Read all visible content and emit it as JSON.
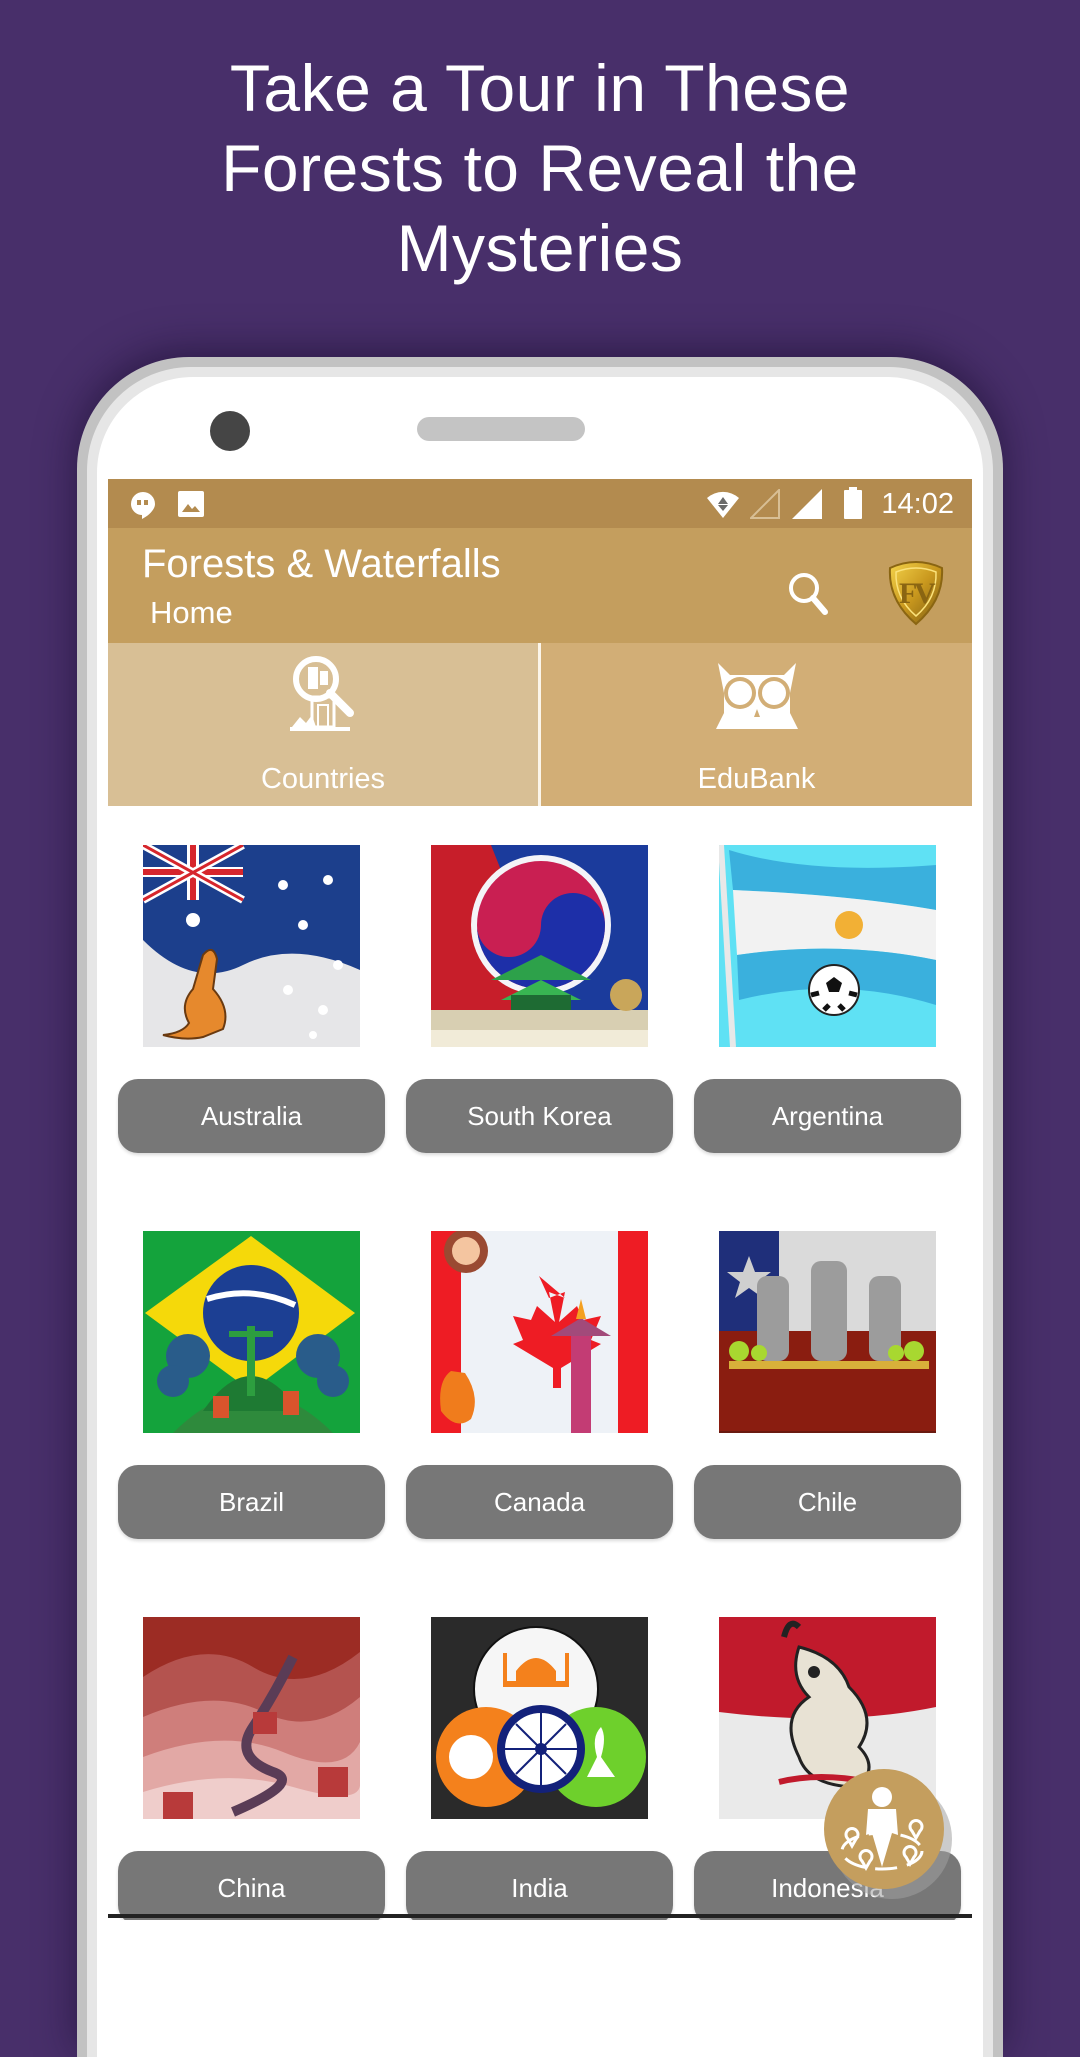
{
  "promo": {
    "headline_lines": [
      "Take a Tour in These",
      "Forests to Reveal the",
      "Mysteries"
    ],
    "background_color": "#482f6a"
  },
  "status_bar": {
    "left_icons": [
      "hangouts-icon",
      "image-notification-icon"
    ],
    "right_icons": [
      "wifi-icon",
      "signal-empty-icon",
      "signal-full-icon",
      "battery-icon"
    ],
    "time": "14:02"
  },
  "app_bar": {
    "title": "Forests & Waterfalls",
    "subtitle": "Home",
    "actions": [
      "search-icon",
      "app-logo-fv"
    ],
    "color": "#c49e5e"
  },
  "tabs": [
    {
      "label": "Countries",
      "icon": "country-search-icon",
      "color": "#d8bf95"
    },
    {
      "label": "EduBank",
      "icon": "owl-icon",
      "color": "#d2ae76"
    }
  ],
  "countries": [
    {
      "name": "Australia",
      "image": "australia-flag-kangaroo"
    },
    {
      "name": "South Korea",
      "image": "south-korea-flag-palace"
    },
    {
      "name": "Argentina",
      "image": "argentina-flag-football"
    },
    {
      "name": "Brazil",
      "image": "brazil-flag-christ-redeemer"
    },
    {
      "name": "Canada",
      "image": "canada-flag-totem"
    },
    {
      "name": "Chile",
      "image": "chile-flag-moai"
    },
    {
      "name": "China",
      "image": "china-great-wall"
    },
    {
      "name": "India",
      "image": "india-taj-mahal-chakra"
    },
    {
      "name": "Indonesia",
      "image": "indonesia-flag-wayang"
    }
  ],
  "fab": {
    "icon": "people-network-icon"
  }
}
